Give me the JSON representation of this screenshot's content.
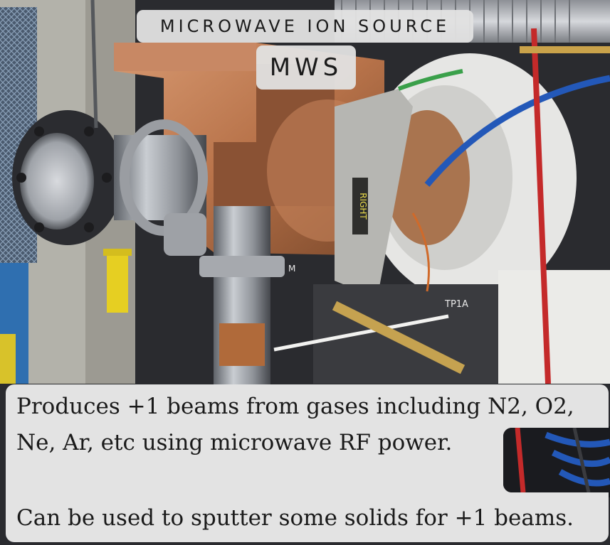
{
  "title": "MICROWAVE ION SOURCE",
  "subtitle": "MWS",
  "description": {
    "line1": "Produces +1 beams from gases including N2, O2,",
    "line2": "Ne, Ar, etc  using microwave RF power.",
    "line3": "Can be used to sputter some solids for +1 beams."
  },
  "photo_labels": {
    "right_plate": "RIGHT",
    "tag": "TP1A",
    "small_tag": "M"
  },
  "colors": {
    "copper": "#b8734a",
    "chamber_white": "#e6e6e4",
    "caption_bg": "#e3e3e3",
    "blue_hose": "#2358b8",
    "red_cable": "#c42a2a"
  }
}
